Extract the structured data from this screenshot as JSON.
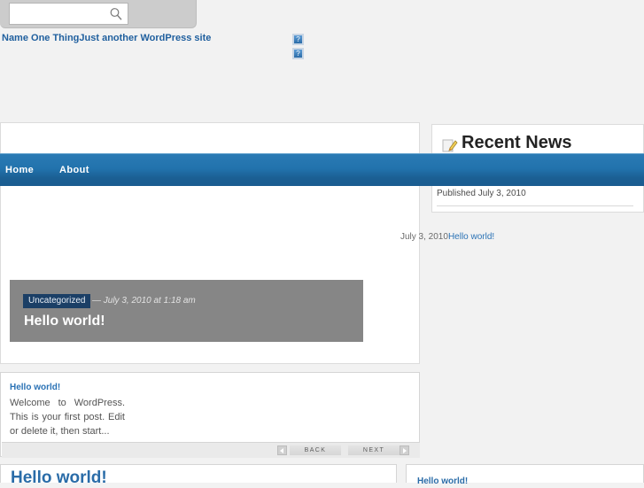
{
  "search": {
    "value": "",
    "placeholder": "",
    "icon": "search-icon"
  },
  "site": {
    "name": "Name One Thing",
    "tagline": "Just another WordPress site"
  },
  "broken_images": [
    {
      "glyph": "?"
    },
    {
      "glyph": "?"
    }
  ],
  "nav": {
    "items": [
      {
        "label": "Home"
      },
      {
        "label": "About"
      }
    ]
  },
  "featured": {
    "category": "Uncategorized",
    "date": "— July 3, 2010 at 1:18 am",
    "title": "Hello world!"
  },
  "sidebar": {
    "heading": "Recent News",
    "heading_icon": "pencil-note-icon",
    "published": "Published July 3, 2010"
  },
  "float_line": {
    "date": "July 3, 2010",
    "link": "Hello world!"
  },
  "excerpt": {
    "title": "Hello world!",
    "body": "Welcome to WordPress. This is your first post. Edit or delete it, then start...",
    "pager": {
      "back": "BACK",
      "next": "NEXT",
      "prev_icon": "triangle-left-icon",
      "next_icon": "triangle-right-icon"
    }
  },
  "bottom": {
    "left_title": "Hello world!",
    "right_title": "Hello world!"
  },
  "colors": {
    "nav_blue": "#2273ad",
    "link_blue": "#2a72b5",
    "badge_navy": "#1b3f66",
    "featured_gray": "#868686",
    "page_bg": "#f2f2f2"
  }
}
